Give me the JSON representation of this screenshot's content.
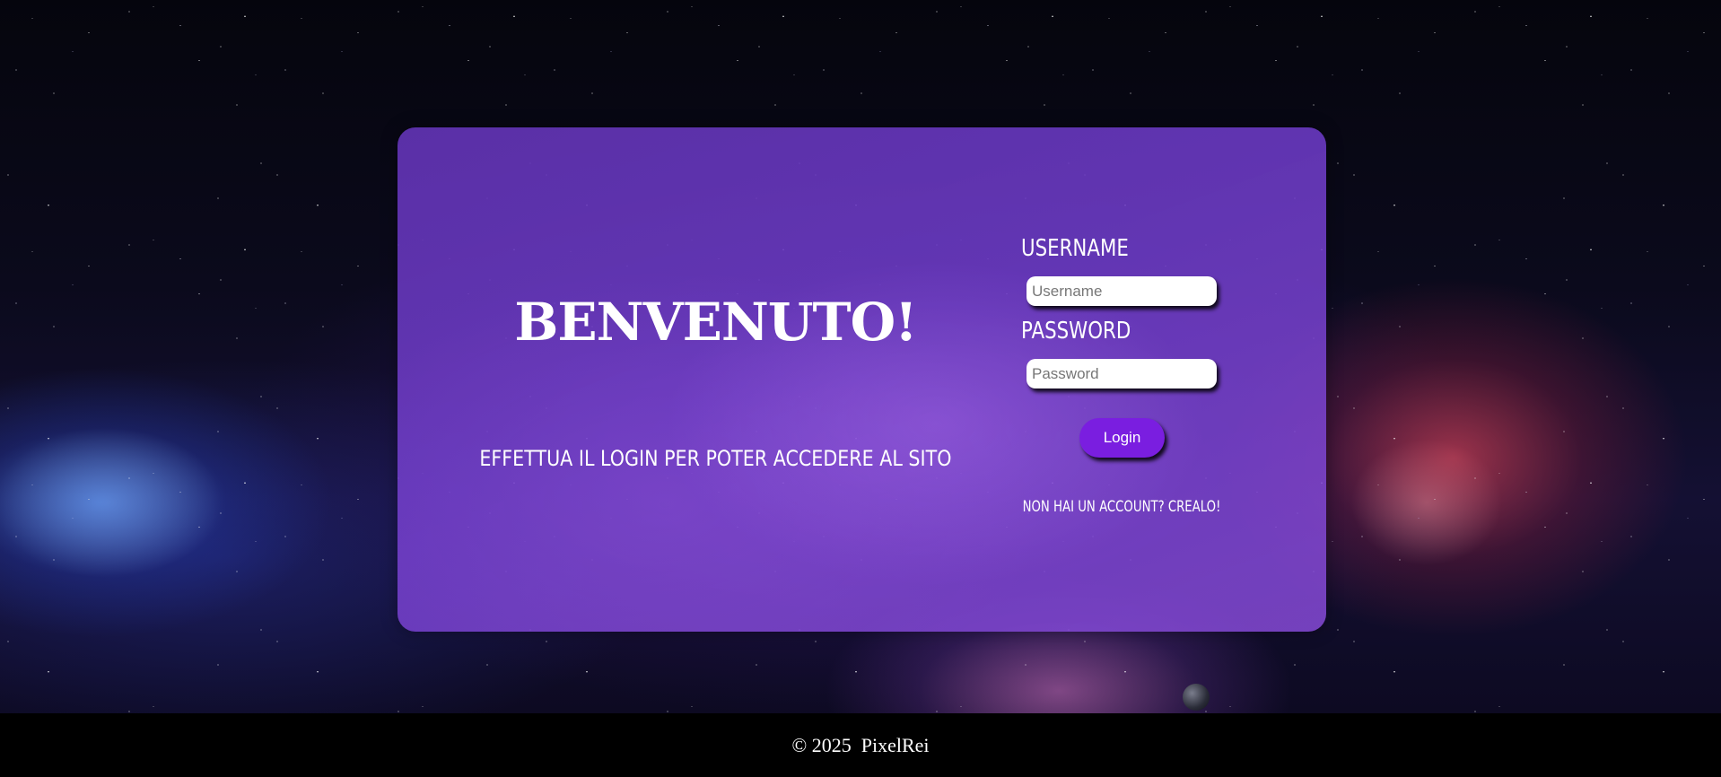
{
  "hero": {
    "title": "BENVENUTO!",
    "subtitle": "EFFETTUA IL LOGIN PER POTER ACCEDERE AL SITO"
  },
  "form": {
    "username_label": "USERNAME",
    "username_placeholder": "Username",
    "username_value": "",
    "password_label": "PASSWORD",
    "password_placeholder": "Password",
    "password_value": "",
    "login_button": "Login",
    "signup_link": "NON HAI UN ACCOUNT? CREALO!"
  },
  "footer": {
    "copyright": "© 2025",
    "brand": "PixelRei"
  },
  "colors": {
    "accent": "#7a1ee0",
    "card": "#6e3cc8",
    "footer_bg": "#000000",
    "text": "#ffffff"
  },
  "icons": {
    "background": "galaxy-background",
    "planet": "planet-icon"
  }
}
